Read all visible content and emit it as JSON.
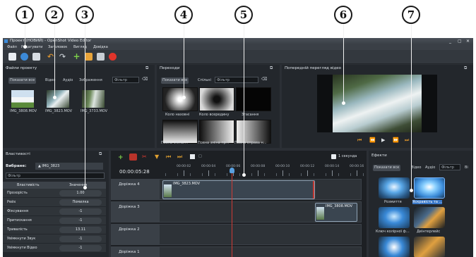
{
  "callouts": [
    "1",
    "2",
    "3",
    "4",
    "5",
    "6",
    "7"
  ],
  "window": {
    "title": "Проект (НОВИЙ) - OpenShot Video Editor",
    "controls": [
      "_",
      "▢",
      "✕"
    ]
  },
  "menu": [
    "Файл",
    "Редагувати",
    "Заголовок",
    "Вигляд",
    "Довідка"
  ],
  "toolbar_icons": [
    "new-project-icon",
    "open-project-icon",
    "save-project-icon",
    "undo-icon",
    "redo-icon",
    "import-files-icon",
    "profile-icon",
    "fullscreen-icon",
    "export-video-icon"
  ],
  "project_files": {
    "title": "Файли проекту",
    "tabs": [
      "Показати все",
      "Відео",
      "Аудіо",
      "Зображення"
    ],
    "filter_placeholder": "Фільтр",
    "files": [
      {
        "name": "IMG_3808.MOV"
      },
      {
        "name": "IMG_3823.MOV"
      },
      {
        "name": "IMG_3733.MOV"
      }
    ]
  },
  "transitions": {
    "title": "Переходи",
    "tabs": [
      "Показати все",
      "Спільні"
    ],
    "filter_placeholder": "Фільтр",
    "items": [
      {
        "name": "Коло назовні"
      },
      {
        "name": "Коло всередину"
      },
      {
        "name": "Згасання"
      },
      {
        "name": "Повна зміна...."
      },
      {
        "name": "Повна зміна пр..."
      },
      {
        "name": "Повна справа н..."
      }
    ]
  },
  "preview": {
    "title": "Попередній перегляд відео",
    "buttons": [
      "jump-start",
      "rewind",
      "play",
      "fast-forward",
      "jump-end"
    ]
  },
  "properties": {
    "title": "Властивості",
    "selection_label": "Вибране:",
    "selection_value": "▲ IMG_3823",
    "filter_placeholder": "Фільтр",
    "col_property": "Властивість",
    "col_value": "Значення",
    "rows": [
      {
        "name": "Прозорість",
        "value": "1.00"
      },
      {
        "name": "Рейх",
        "value": "Помилка"
      },
      {
        "name": "Фіксування",
        "value": "-1"
      },
      {
        "name": "Притискання",
        "value": "-1"
      },
      {
        "name": "Тривалість",
        "value": "13.11"
      },
      {
        "name": "Увімкнути Звук",
        "value": "-1"
      },
      {
        "name": "Увімкнути Відео",
        "value": "-1"
      }
    ]
  },
  "timeline": {
    "time": "00:00:05:28",
    "seconds_label": "1 секунда",
    "ruler": [
      "00:00:02",
      "00:00:04",
      "00:00:06",
      "00:00:08",
      "00:00:10",
      "00:00:12",
      "00:00:14",
      "00:00:16"
    ],
    "playhead_seconds": 5.9,
    "tracks": [
      {
        "name": "Доріжка 4",
        "clips": [
          {
            "name": "IMG_3823.MOV"
          }
        ]
      },
      {
        "name": "Доріжка 3",
        "clips": [
          {
            "name": "IMG_3808.MOV"
          }
        ]
      },
      {
        "name": "Доріжка 2",
        "clips": []
      },
      {
        "name": "Доріжка 1",
        "clips": []
      }
    ]
  },
  "effects": {
    "title": "Ефекти",
    "tabs": [
      "Показати все",
      "Відео",
      "Аудіо",
      "Фільтр",
      "Ві"
    ],
    "items": [
      {
        "name": "Розмиття"
      },
      {
        "name": "Яскравість та ..."
      },
      {
        "name": "Ключ колірної ф..."
      },
      {
        "name": "Деінтерлейс"
      },
      {
        "name": ""
      },
      {
        "name": ""
      }
    ]
  }
}
